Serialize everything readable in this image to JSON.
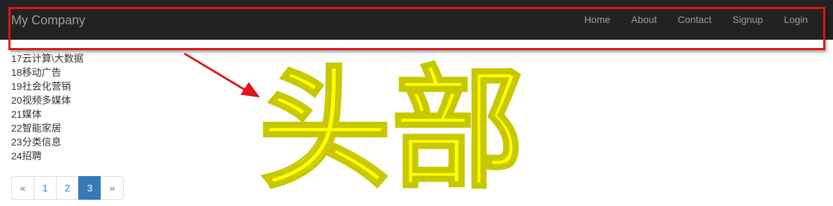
{
  "navbar": {
    "brand": "My Company",
    "links": [
      "Home",
      "About",
      "Contact",
      "Signup",
      "Login"
    ]
  },
  "categories": [
    "17云计算\\大数据",
    "18移动广告",
    "19社会化营销",
    "20视频多媒体",
    "21媒体",
    "22智能家居",
    "23分类信息",
    "24招聘"
  ],
  "pagination": {
    "prev": "«",
    "pages": [
      "1",
      "2",
      "3"
    ],
    "active": "3",
    "next": "»"
  },
  "annotation": {
    "text": "头部",
    "box_color": "#e0141b",
    "text_color": "#ffff00"
  }
}
